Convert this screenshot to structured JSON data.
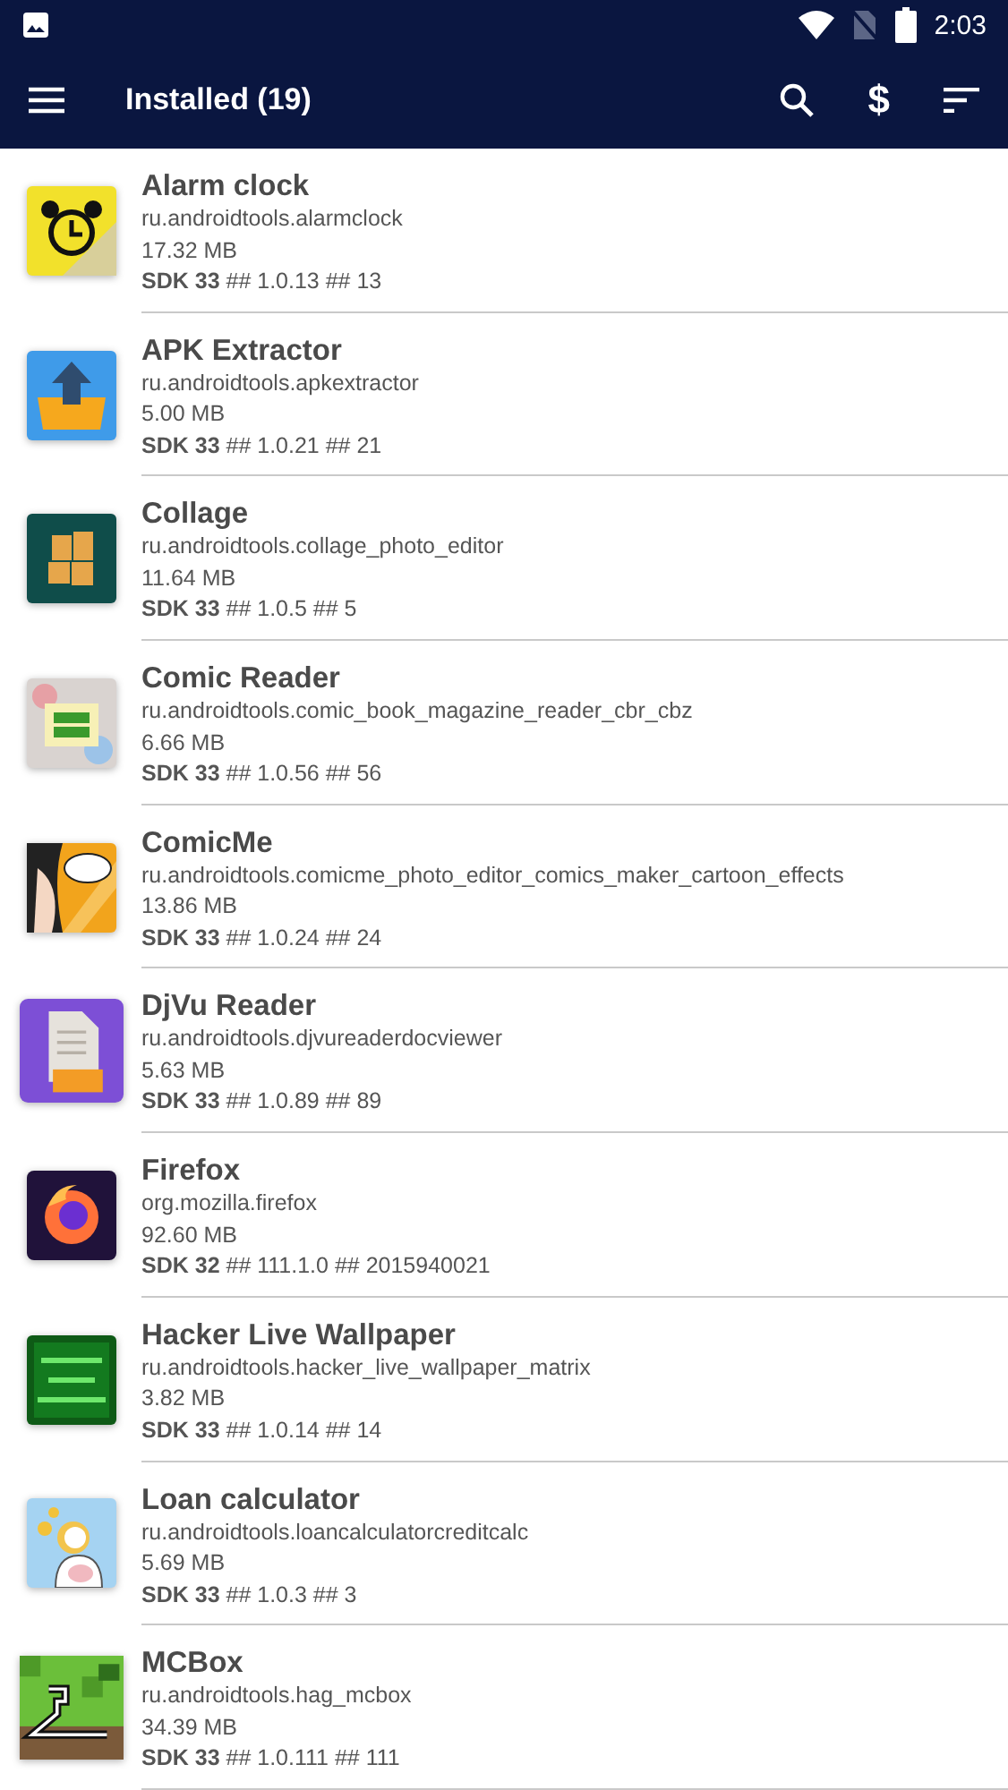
{
  "status_bar": {
    "time": "2:03"
  },
  "app_bar": {
    "title": "Installed (19)",
    "donate_button": "$"
  },
  "apps": [
    {
      "name": "Alarm clock",
      "package": "ru.androidtools.alarmclock",
      "size": "17.32 MB",
      "version": "**SDK 33** ## 1.0.13 ## 13"
    },
    {
      "name": "APK Extractor",
      "package": "ru.androidtools.apkextractor",
      "size": "5.00 MB",
      "version": "**SDK 33** ## 1.0.21 ## 21"
    },
    {
      "name": "Collage",
      "package": "ru.androidtools.collage_photo_editor",
      "size": "11.64 MB",
      "version": "**SDK 33** ## 1.0.5 ## 5"
    },
    {
      "name": "Comic Reader",
      "package": "ru.androidtools.comic_book_magazine_reader_cbr_cbz",
      "size": "6.66 MB",
      "version": "**SDK 33** ## 1.0.56 ## 56"
    },
    {
      "name": "ComicMe",
      "package": "ru.androidtools.comicme_photo_editor_comics_maker_cartoon_effects",
      "size": "13.86 MB",
      "version": "**SDK 33** ## 1.0.24 ## 24"
    },
    {
      "name": "DjVu Reader",
      "package": "ru.androidtools.djvureaderdocviewer",
      "size": "5.63 MB",
      "version": "**SDK 33** ## 1.0.89 ## 89"
    },
    {
      "name": "Firefox",
      "package": "org.mozilla.firefox",
      "size": "92.60 MB",
      "version": "**SDK 32** ## 111.1.0 ## 2015940021"
    },
    {
      "name": "Hacker Live Wallpaper",
      "package": "ru.androidtools.hacker_live_wallpaper_matrix",
      "size": "3.82 MB",
      "version": "**SDK 33** ## 1.0.14 ## 14"
    },
    {
      "name": "Loan calculator",
      "package": "ru.androidtools.loancalculatorcreditcalc",
      "size": "5.69 MB",
      "version": "**SDK 33** ## 1.0.3 ## 3"
    },
    {
      "name": "MCBox",
      "package": "ru.androidtools.hag_mcbox",
      "size": "34.39 MB",
      "version": "**SDK 33** ## 1.0.111 ## 111"
    }
  ]
}
